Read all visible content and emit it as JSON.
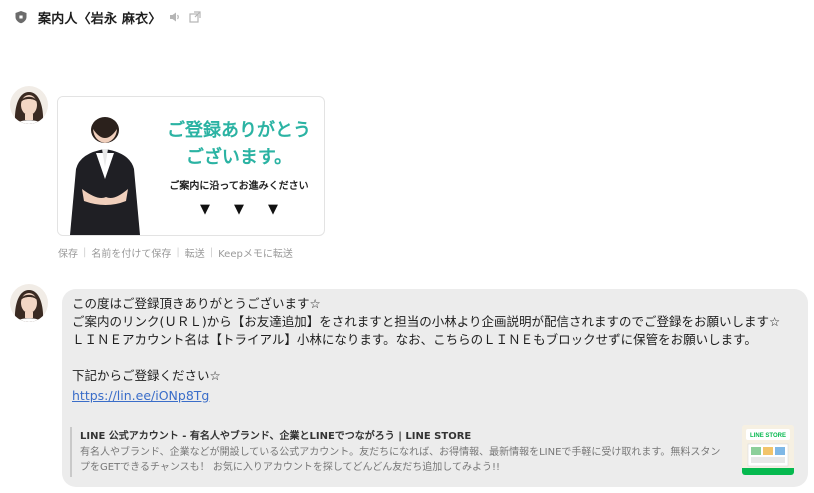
{
  "header": {
    "title": "案内人〈岩永 麻衣〉",
    "icons": [
      "shield-icon",
      "speaker-icon",
      "open-window-icon"
    ]
  },
  "image_message": {
    "headline_line1": "ご登録ありがとう",
    "headline_line2": "ございます。",
    "subtext": "ご案内に沿ってお進みください",
    "arrows": [
      "▼",
      "▼",
      "▼"
    ],
    "accent_color": "#2bb3a3"
  },
  "image_actions": {
    "save": "保存",
    "save_as": "名前を付けて保存",
    "forward": "転送",
    "keep_forward": "Keepメモに転送"
  },
  "text_message": {
    "lines": [
      "この度はご登録頂きありがとうございます☆",
      "ご案内のリンク(ＵＲＬ)から【お友達追加】をされますと担当の小林より企画説明が配信されますのでご登録をお願いします☆",
      "ＬＩＮＥアカウント名は【トライアル】小林になります。なお、こちらのＬＩＮＥもブロックせずに保管をお願いします。"
    ],
    "cta": "下記からご登録ください☆",
    "link": "https://lin.ee/iONp8Tg"
  },
  "link_preview": {
    "title": "LINE 公式アカウント - 有名人やブランド、企業とLINEでつながろう | LINE STORE",
    "description": "有名人やブランド、企業などが開設している公式アカウント。友だちになれば、お得情報、最新情報をLINEで手軽に受け取れます。無料スタンプをGETできるチャンスも！ お気に入りアカウントを探してどんどん友だち追加してみよう!!",
    "thumb_label": "LINE STORE"
  }
}
